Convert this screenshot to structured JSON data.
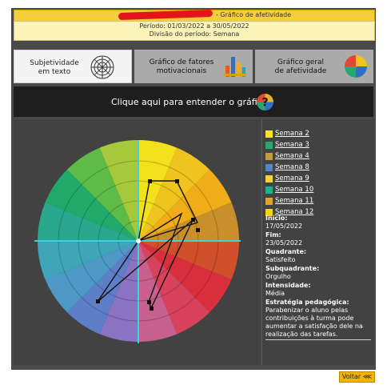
{
  "header": {
    "title_suffix": "- Gráfico de afetividade",
    "period_line": "Período: 01/03/2022 a 30/05/2022",
    "division_line": "Divisão do período: Semana"
  },
  "tabs": [
    {
      "line1": "Subjetividade",
      "line2": "em texto",
      "active": true
    },
    {
      "line1": "Gráfico de fatores",
      "line2": "motivacionais",
      "active": false
    },
    {
      "line1": "Gráfico geral",
      "line2": "de afetividade",
      "active": false
    }
  ],
  "banner": {
    "text": "Clique aqui para entender o gráfico.",
    "help_icon": "question-mark-icon"
  },
  "legend": [
    {
      "label": "Semana 2",
      "color": "#f2e52b"
    },
    {
      "label": "Semana 3",
      "color": "#2aa675"
    },
    {
      "label": "Semana 4",
      "color": "#c49a3a"
    },
    {
      "label": "Semana 8",
      "color": "#5a84c8"
    },
    {
      "label": "Semana 9",
      "color": "#f0d43a"
    },
    {
      "label": "Semana 10",
      "color": "#1bb38a"
    },
    {
      "label": "Semana 11",
      "color": "#d9a431"
    },
    {
      "label": "Semana 12",
      "color": "#f3d21e"
    }
  ],
  "info": {
    "inicio_label": "Início:",
    "inicio_value": "17/05/2022",
    "fim_label": "Fim:",
    "fim_value": "23/05/2022",
    "quadrante_label": "Quadrante:",
    "quadrante_value": "Satisfeito",
    "subquadrante_label": "Subquadrante:",
    "subquadrante_value": "Orgulho",
    "intensidade_label": "Intensidade:",
    "intensidade_value": "Média",
    "estrategia_label": "Estratégia pedagógica:",
    "estrategia_value": "Parabenizar o aluno pelas contribuições à turma pode aumentar a satisfação dele na realização das tarefas."
  },
  "back_button": "Voltar ⋘"
}
